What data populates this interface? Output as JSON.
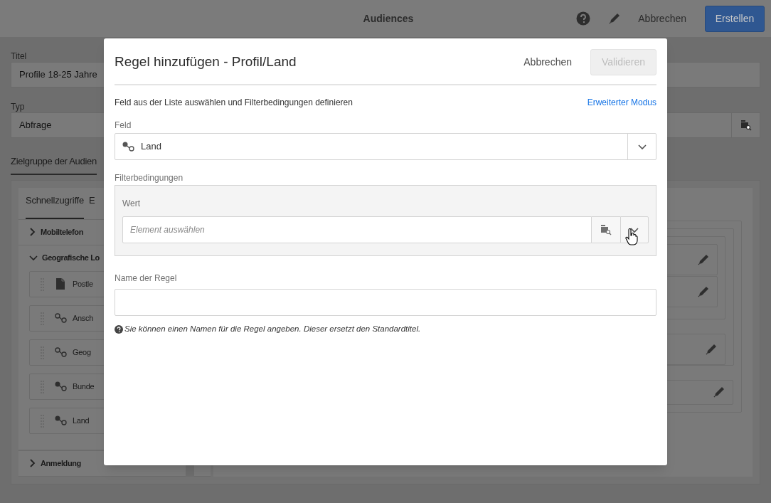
{
  "header": {
    "title": "Audiences",
    "cancel": "Abbrechen",
    "create": "Erstellen"
  },
  "form": [
    {
      "label": "Titel",
      "value": "Profile 18-25 Jahre",
      "kind": "text"
    },
    {
      "label": "Typ",
      "value": "Abfrage",
      "kind": "picker"
    }
  ],
  "section_tabs": [
    {
      "label": "Zielgruppe der Audien",
      "selected": true
    }
  ],
  "palette": {
    "tabs": [
      {
        "label": "Schnellzugriffe",
        "selected": true
      },
      {
        "label": "E",
        "selected": false
      }
    ],
    "groups": [
      {
        "label": "Mobiltelefon",
        "expanded": false
      },
      {
        "label": "Geografische Lo",
        "expanded": true,
        "items": [
          {
            "label": "Postle",
            "kind": "document"
          },
          {
            "label": "Ansch",
            "kind": "link-outline"
          },
          {
            "label": "Geog",
            "kind": "link-outline"
          },
          {
            "label": "Bunde",
            "kind": "link"
          },
          {
            "label": "Land",
            "kind": "link"
          }
        ]
      },
      {
        "label": "Anmeldung",
        "expanded": false
      }
    ]
  },
  "dialog": {
    "title": "Regel hinzufügen - Profil/Land",
    "cancel": "Abbrechen",
    "validate": {
      "label": "Validieren",
      "disabled": true
    },
    "instruction": "Feld aus der Liste auswählen und Filterbedingungen definieren",
    "advanced_link": "Erweiterter Modus",
    "field": {
      "label": "Feld",
      "value": "Land"
    },
    "filter": {
      "label": "Filterbedingungen",
      "value_label": "Wert",
      "placeholder": "Element auswählen"
    },
    "rule_name": {
      "label": "Name der Regel"
    },
    "hint": "Sie können einen Namen für die Regel angeben. Dieser ersetzt den Standardtitel."
  }
}
